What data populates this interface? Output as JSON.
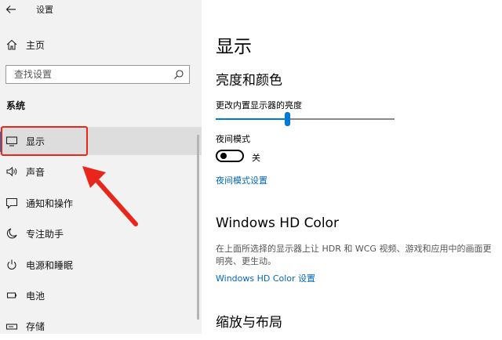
{
  "window": {
    "title": "设置"
  },
  "sidebar": {
    "home": "主页",
    "search_placeholder": "查找设置",
    "section": "系统",
    "items": [
      {
        "label": "显示",
        "icon": "monitor-icon",
        "selected": true
      },
      {
        "label": "声音",
        "icon": "speaker-icon"
      },
      {
        "label": "通知和操作",
        "icon": "notification-icon"
      },
      {
        "label": "专注助手",
        "icon": "moon-icon"
      },
      {
        "label": "电源和睡眠",
        "icon": "power-icon"
      },
      {
        "label": "电池",
        "icon": "battery-icon"
      },
      {
        "label": "存储",
        "icon": "storage-icon"
      }
    ]
  },
  "main": {
    "title": "显示",
    "brightness_section": "亮度和颜色",
    "brightness_label": "更改内置显示器的亮度",
    "brightness_value": 0.4,
    "night_mode_label": "夜间模式",
    "night_mode_state": "关",
    "night_mode_link": "夜间模式设置",
    "hd_title": "Windows HD Color",
    "hd_desc": "在上面所选择的显示器上让 HDR 和 WCG 视频、游戏和应用中的画面更明亮、更生动。",
    "hd_link": "Windows HD Color 设置",
    "scale_title": "缩放与布局"
  },
  "colors": {
    "accent": "#0078d7",
    "link": "#0067c0",
    "annotation": "#e8261b"
  }
}
